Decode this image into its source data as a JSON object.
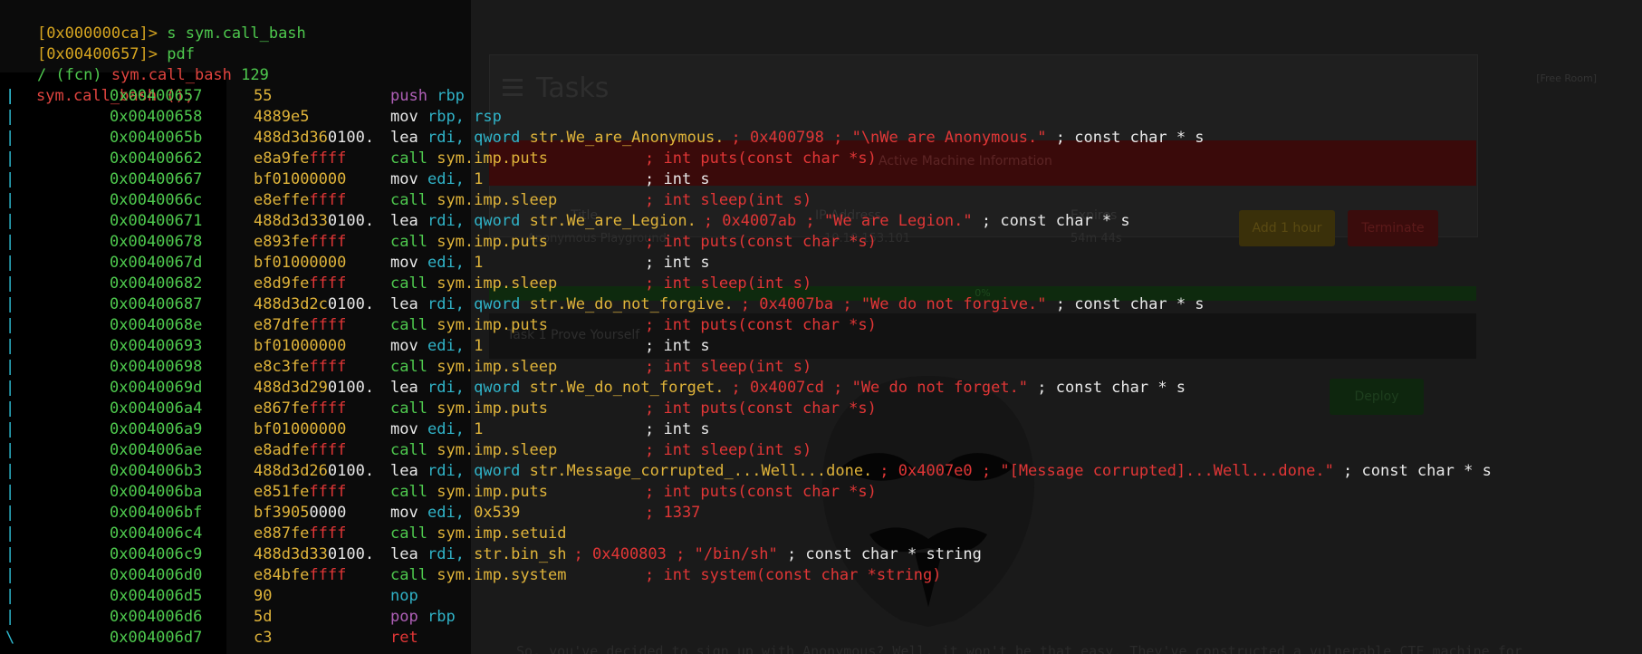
{
  "terminal": {
    "prompt1": "[0x000000ca]>",
    "cmd1": " s sym.call_bash",
    "prompt2": "[0x00400657]>",
    "cmd2": " pdf",
    "fcn_header_prefix": "/ (fcn) ",
    "fcn_header_name": "sym.call_bash",
    "fcn_header_size": " 129",
    "fcn_signature": "sym.call_bash ();",
    "bar_char": "|",
    "end_char": "\\",
    "rows": [
      {
        "addr": "0x00400657",
        "b1": "55",
        "b2": "",
        "b3": "",
        "mn": "push",
        "op1": "rbp",
        "op1c": "c",
        "op2": "",
        "cm": "",
        "cmc": ""
      },
      {
        "addr": "0x00400658",
        "b1": "48",
        "b2": "89e5",
        "b3": "",
        "mn": "mov",
        "op1": "rbp, rsp",
        "op1c": "c",
        "op2": "",
        "cm": "",
        "cmc": ""
      },
      {
        "addr": "0x0040065b",
        "b1": "48",
        "b2": "8d3d36",
        "b3": "0100.",
        "mn": "lea",
        "op1": "rdi,",
        "op1c": "c",
        "op2": "qword str.We_are_Anonymous.",
        "cm": "; 0x400798 ; \"\\nWe are Anonymous.\"",
        "cm2": " ; const char * s",
        "cmc": "r"
      },
      {
        "addr": "0x00400662",
        "b1": "e8a9fe",
        "b2": "ffff",
        "b3": "",
        "mn": "call",
        "op1": "sym.imp.puts",
        "op1c": "y",
        "op2": "",
        "cm": "; int puts(const char *s)",
        "cmc": "r"
      },
      {
        "addr": "0x00400667",
        "b1": "bf01",
        "b2": "000000",
        "b3": "",
        "mn": "mov",
        "op1": "edi,",
        "op1c": "c",
        "op2": "1",
        "cm": "; int s",
        "cmc": "w"
      },
      {
        "addr": "0x0040066c",
        "b1": "e8effe",
        "b2": "ffff",
        "b3": "",
        "mn": "call",
        "op1": "sym.imp.sleep",
        "op1c": "y",
        "op2": "",
        "cm": "; int sleep(int s)",
        "cmc": "r"
      },
      {
        "addr": "0x00400671",
        "b1": "48",
        "b2": "8d3d33",
        "b3": "0100.",
        "mn": "lea",
        "op1": "rdi,",
        "op1c": "c",
        "op2": "qword str.We_are_Legion.",
        "cm": "; 0x4007ab ; \"We are Legion.\"",
        "cm2": " ; const char * s",
        "cmc": "r"
      },
      {
        "addr": "0x00400678",
        "b1": "e893fe",
        "b2": "ffff",
        "b3": "",
        "mn": "call",
        "op1": "sym.imp.puts",
        "op1c": "y",
        "op2": "",
        "cm": "; int puts(const char *s)",
        "cmc": "r"
      },
      {
        "addr": "0x0040067d",
        "b1": "bf01",
        "b2": "000000",
        "b3": "",
        "mn": "mov",
        "op1": "edi,",
        "op1c": "c",
        "op2": "1",
        "cm": "; int s",
        "cmc": "w"
      },
      {
        "addr": "0x00400682",
        "b1": "e8d9fe",
        "b2": "ffff",
        "b3": "",
        "mn": "call",
        "op1": "sym.imp.sleep",
        "op1c": "y",
        "op2": "",
        "cm": "; int sleep(int s)",
        "cmc": "r"
      },
      {
        "addr": "0x00400687",
        "b1": "48",
        "b2": "8d3d2c",
        "b3": "0100.",
        "mn": "lea",
        "op1": "rdi,",
        "op1c": "c",
        "op2": "qword str.We_do_not_forgive.",
        "cm": "; 0x4007ba ; \"We do not forgive.\"",
        "cm2": " ; const char * s",
        "cmc": "r"
      },
      {
        "addr": "0x0040068e",
        "b1": "e87dfe",
        "b2": "ffff",
        "b3": "",
        "mn": "call",
        "op1": "sym.imp.puts",
        "op1c": "y",
        "op2": "",
        "cm": "; int puts(const char *s)",
        "cmc": "r"
      },
      {
        "addr": "0x00400693",
        "b1": "bf01",
        "b2": "000000",
        "b3": "",
        "mn": "mov",
        "op1": "edi,",
        "op1c": "c",
        "op2": "1",
        "cm": "; int s",
        "cmc": "w"
      },
      {
        "addr": "0x00400698",
        "b1": "e8c3fe",
        "b2": "ffff",
        "b3": "",
        "mn": "call",
        "op1": "sym.imp.sleep",
        "op1c": "y",
        "op2": "",
        "cm": "; int sleep(int s)",
        "cmc": "r"
      },
      {
        "addr": "0x0040069d",
        "b1": "48",
        "b2": "8d3d29",
        "b3": "0100.",
        "mn": "lea",
        "op1": "rdi,",
        "op1c": "c",
        "op2": "qword str.We_do_not_forget.",
        "cm": "; 0x4007cd ; \"We do not forget.\"",
        "cm2": " ; const char * s",
        "cmc": "r"
      },
      {
        "addr": "0x004006a4",
        "b1": "e867fe",
        "b2": "ffff",
        "b3": "",
        "mn": "call",
        "op1": "sym.imp.puts",
        "op1c": "y",
        "op2": "",
        "cm": "; int puts(const char *s)",
        "cmc": "r"
      },
      {
        "addr": "0x004006a9",
        "b1": "bf01",
        "b2": "000000",
        "b3": "",
        "mn": "mov",
        "op1": "edi,",
        "op1c": "c",
        "op2": "1",
        "cm": "; int s",
        "cmc": "w"
      },
      {
        "addr": "0x004006ae",
        "b1": "e8adfe",
        "b2": "ffff",
        "b3": "",
        "mn": "call",
        "op1": "sym.imp.sleep",
        "op1c": "y",
        "op2": "",
        "cm": "; int sleep(int s)",
        "cmc": "r"
      },
      {
        "addr": "0x004006b3",
        "b1": "48",
        "b2": "8d3d26",
        "b3": "0100.",
        "mn": "lea",
        "op1": "rdi,",
        "op1c": "c",
        "op2": "qword str.Message_corrupted_...Well...done.",
        "cm": "; 0x4007e0 ; \"[Message corrupted]...Well...done.\"",
        "cm2": " ; const char * s",
        "cmc": "r"
      },
      {
        "addr": "0x004006ba",
        "b1": "e851fe",
        "b2": "ffff",
        "b3": "",
        "mn": "call",
        "op1": "sym.imp.puts",
        "op1c": "y",
        "op2": "",
        "cm": "; int puts(const char *s)",
        "cmc": "r"
      },
      {
        "addr": "0x004006bf",
        "b1": "bf39",
        "b2": "05",
        "b3": "0000",
        "mn": "mov",
        "op1": "edi,",
        "op1c": "c",
        "op2": "0x539",
        "cm": "; 1337",
        "cmc": "r"
      },
      {
        "addr": "0x004006c4",
        "b1": "e887fe",
        "b2": "ffff",
        "b3": "",
        "mn": "call",
        "op1": "sym.imp.setuid",
        "op1c": "y",
        "op2": "",
        "cm": "",
        "cmc": ""
      },
      {
        "addr": "0x004006c9",
        "b1": "48",
        "b2": "8d3d33",
        "b3": "0100.",
        "mn": "lea",
        "op1": "rdi,",
        "op1c": "c",
        "op2": "str.bin_sh",
        "cm": "; 0x400803 ; \"/bin/sh\"",
        "cm2": " ; const char * string",
        "cmc": "r"
      },
      {
        "addr": "0x004006d0",
        "b1": "e84bfe",
        "b2": "ffff",
        "b3": "",
        "mn": "call",
        "op1": "sym.imp.system",
        "op1c": "y",
        "op2": "",
        "cm": "; int system(const char *string)",
        "cmc": "r"
      },
      {
        "addr": "0x004006d5",
        "b1": "90",
        "b2": "",
        "b3": "",
        "mn": "nop",
        "op1": "",
        "op1c": "",
        "op2": "",
        "cm": "",
        "cmc": ""
      },
      {
        "addr": "0x004006d6",
        "b1": "5d",
        "b2": "",
        "b3": "",
        "mn": "pop",
        "op1": "rbp",
        "op1c": "c",
        "op2": "",
        "cm": "",
        "cmc": ""
      },
      {
        "addr": "0x004006d7",
        "b1": "c3",
        "b2": "",
        "b3": "",
        "mn": "ret",
        "op1": "",
        "op1c": "",
        "op2": "",
        "cm": "",
        "cmc": ""
      }
    ]
  },
  "background_page": {
    "title": "Tasks",
    "free_room": "[Free Room]",
    "active_machine": "Active Machine Information",
    "col_title": "Title",
    "col_ip": "IP Address",
    "col_expires": "Expires",
    "val_title": "Anonymous Playground",
    "val_ip": "10.10.153.101",
    "val_expires": "54m 44s",
    "add_hour": "Add 1 hour",
    "terminate": "Terminate",
    "progress": "0%",
    "task_label": "Task 1  Prove Yourself",
    "deploy": "Deploy",
    "footer": "So, you've decided to sign up with Anonymous?  Well, it won't be that easy.  They've constructed a vulnerable CTF machine for"
  }
}
